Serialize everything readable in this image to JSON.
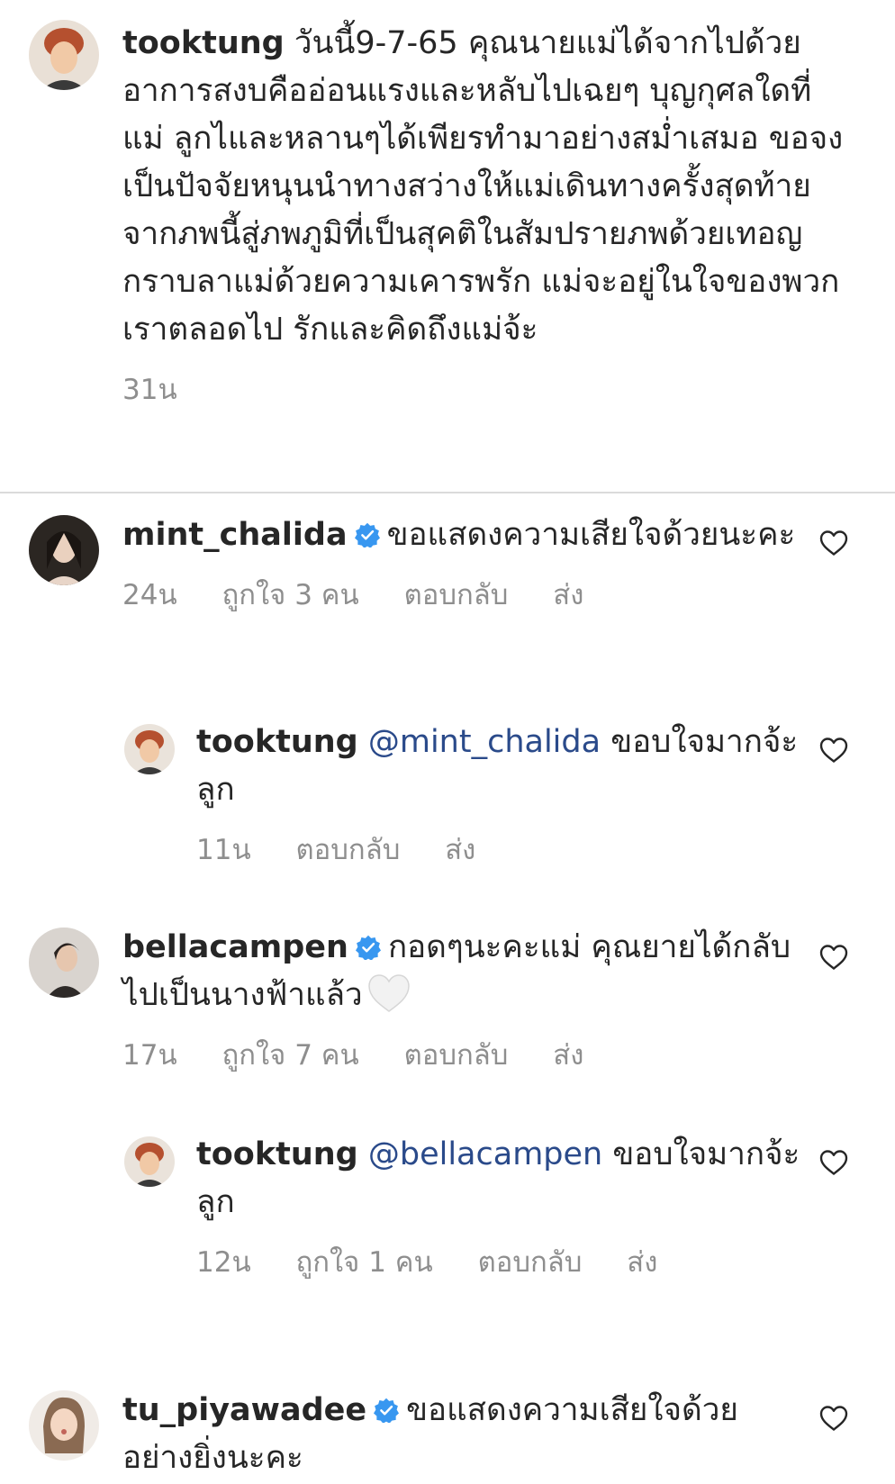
{
  "caption": {
    "username": "tooktung",
    "text": "วันนี้9-7-65 คุณนายแม่ได้จากไปด้วยอาการสงบคืออ่อนแรงและหลับไปเฉยๆ บุญกุศลใดที่แม่ ลูกไและหลานๆได้เพียรทำมาอย่างสม่ำเสมอ ขอจงเป็นปัจจัยหนุนนำทางสว่างให้แม่เดินทางครั้งสุดท้ายจากภพนี้สู่ภพภูมิที่เป็นสุคติในสัมปรายภพด้วยเทอญ กราบลาแม่ด้วยความเคารพรัก แม่จะอยู่ในใจของพวกเราตลอดไป รักและคิดถึงแม่จ้ะ",
    "time": "31น"
  },
  "comments": [
    {
      "username": "mint_chalida",
      "verified": true,
      "text": "ขอแสดงความเสียใจด้วยนะคะ",
      "time": "24น",
      "likes": "ถูกใจ 3 คน",
      "reply_label": "ตอบกลับ",
      "send_label": "ส่ง"
    },
    {
      "username": "tooktung",
      "mention": "@mint_chalida",
      "text": "ขอบใจมากจ้ะลูก",
      "time": "11น",
      "reply_label": "ตอบกลับ",
      "send_label": "ส่ง"
    },
    {
      "username": "bellacampen",
      "verified": true,
      "text": "กอดๆนะคะแม่ คุณยายได้กลับไปเป็นนางฟ้าแล้ว",
      "time": "17น",
      "likes": "ถูกใจ 7 คน",
      "reply_label": "ตอบกลับ",
      "send_label": "ส่ง"
    },
    {
      "username": "tooktung",
      "mention": "@bellacampen",
      "text": "ขอบใจมากจ้ะลูก",
      "time": "12น",
      "likes": "ถูกใจ 1 คน",
      "reply_label": "ตอบกลับ",
      "send_label": "ส่ง"
    },
    {
      "username": "tu_piyawadee",
      "verified": true,
      "text": "ขอแสดงความเสียใจด้วยอย่างยิ่งนะคะ"
    }
  ],
  "colors": {
    "verified": "#3897f0",
    "mention": "#2a4a8a",
    "meta": "#8e8e8e",
    "divider": "#dbdbdb"
  },
  "icons": {
    "verified": "verified-badge-icon",
    "like": "heart-outline-icon",
    "emoji": "white-heart-emoji"
  }
}
